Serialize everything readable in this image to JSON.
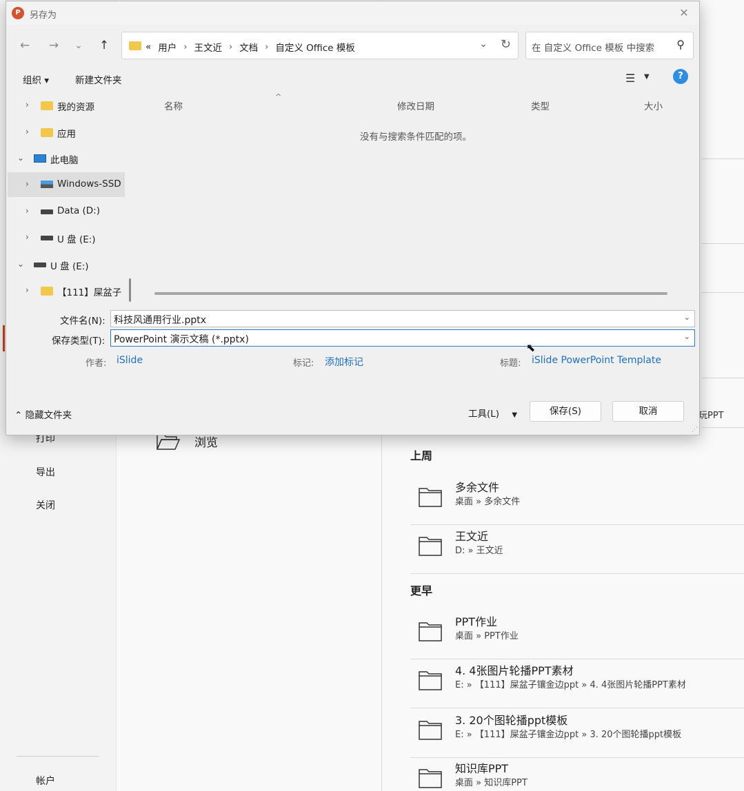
{
  "background": {
    "nav": {
      "print": "打印",
      "export": "导出",
      "close": "关闭",
      "account": "帐户"
    },
    "browse_label": "浏览",
    "partial_ppt": "玩PPT",
    "section_last_week": "上周",
    "section_earlier": "更早",
    "recent_last_week": [
      {
        "name": "多余文件",
        "path": "桌面 » 多余文件"
      },
      {
        "name": "王文近",
        "path": "D: » 王文近"
      }
    ],
    "recent_earlier": [
      {
        "name": "PPT作业",
        "path": "桌面 » PPT作业"
      },
      {
        "name": "4. 4张图片轮播PPT素材",
        "path": "E: » 【111】屎盆子镶金边ppt » 4. 4张图片轮播PPT素材"
      },
      {
        "name": "3. 20个图轮播ppt模板",
        "path": "E: » 【111】屎盆子镶金边ppt » 3. 20个图轮播ppt模板"
      },
      {
        "name": "知识库PPT",
        "path": "桌面 » 知识库PPT"
      }
    ]
  },
  "dialog": {
    "title": "另存为",
    "app_icon_letter": "P",
    "nav": {
      "back": "←",
      "forward": "→",
      "recent": "⌄",
      "up": "↑"
    },
    "address": {
      "prefix": "«",
      "crumbs": [
        "用户",
        "王文近",
        "文档",
        "自定义 Office 模板"
      ],
      "separator": "›"
    },
    "search_placeholder": "在 自定义 Office 模板 中搜索",
    "toolbar": {
      "organize": "组织 ▾",
      "new_folder": "新建文件夹"
    },
    "tree": [
      {
        "label": "我的资源"
      },
      {
        "label": "应用"
      },
      {
        "label": "此电脑"
      },
      {
        "label": "Windows-SSD"
      },
      {
        "label": "Data (D:)"
      },
      {
        "label": "U 盘 (E:)"
      },
      {
        "label": "U 盘 (E:)"
      },
      {
        "label": "【111】屎盆子"
      }
    ],
    "columns": [
      "名称",
      "修改日期",
      "类型",
      "大小"
    ],
    "empty_message": "没有与搜索条件匹配的项。",
    "filename_label": "文件名(N):",
    "filename_value": "科技风通用行业.pptx",
    "filetype_label": "保存类型(T):",
    "filetype_value": "PowerPoint 演示文稿 (*.pptx)",
    "author_label": "作者:",
    "author_value": "iSlide",
    "tags_label": "标记:",
    "tags_value": "添加标记",
    "title_label": "标题:",
    "title_value": "iSlide PowerPoint Template",
    "hide_folders": "隐藏文件夹",
    "tools": "工具(L)",
    "save": "保存(S)",
    "cancel": "取消"
  },
  "colors": {
    "accent": "#2a78c6",
    "folder": "#f1c84b",
    "help": "#2f8ee0",
    "link": "#1e6fc2"
  }
}
